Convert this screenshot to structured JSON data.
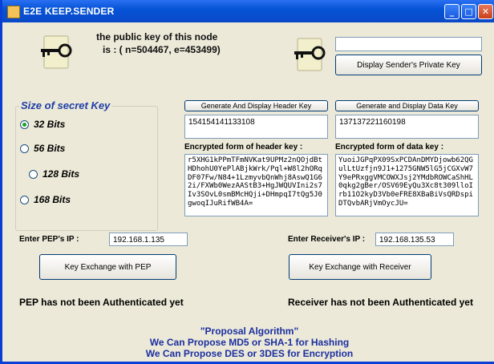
{
  "window": {
    "title": "E2E KEEP.SENDER",
    "buttons": [
      "minimize",
      "maximize",
      "close"
    ]
  },
  "public_key": {
    "line1": "the public key of this node",
    "line2": "is : ( n=504467, e=453499)"
  },
  "private_key": {
    "field_value": "",
    "button_label": "Display Sender's Private Key"
  },
  "secret_key_size": {
    "title": "Size of secret Key",
    "options": [
      "32 Bits",
      "56 Bits",
      "128 Bits",
      "168 Bits"
    ],
    "selected": "32 Bits"
  },
  "header_key": {
    "button_label": "Generate And Display Header Key",
    "value": "154154141133108",
    "encrypted_label": "Encrypted form of header key :",
    "encrypted_value": "r5XHG1kPPmTFmNVKat9UPMz2nQOjdBtHDhohU0YePlABjkWrk/Pql+W8l2hORqDF07Fw/N84+1LzmyvbQnWhj8AswQ1G62i/FXWb0WezAAStB3+HgJWQUVIni2s7Iv3SOvL0smBMcHQji+DHmpqI7tQg5J0gwoqIJuRifWB4A="
  },
  "data_key": {
    "button_label": "Generate and Display Data Key",
    "value": "137137221160198",
    "encrypted_label": "Encrypted form of data key :",
    "encrypted_value": "YuoiJGPqPX09SxPCDAnDMYDjowb62QGulLtUzfjn9J1+1275GNW5lG5jCGXvW7Y9ePRxggVMCOWXJsj2YMdbROWCaShHL0qkg2gBer/OSV69EyQu3Xc8t309lloIrb11O2kyD3Vb0eFRE8XBaBiVsQRDspiDTQvbARjVmOycJU="
  },
  "pep": {
    "ip_label": "Enter PEP's IP :",
    "ip_value": "192.168.1.135",
    "button_label": "Key Exchange with PEP",
    "status": "PEP has not been Authenticated yet"
  },
  "receiver": {
    "ip_label": "Enter Receiver's IP :",
    "ip_value": "192.168.135.53",
    "button_label": "Key Exchange with Receiver",
    "status": "Receiver has not been Authenticated yet"
  },
  "proposal": {
    "line1": "\"Proposal Algorithm\"",
    "line2": "We Can Propose MD5 or SHA-1 for Hashing",
    "line3": "We Can Propose DES or 3DES for Encryption"
  },
  "colors": {
    "titlebar": "#0553d6",
    "window_bg": "#ece9d8",
    "group_title": "#1f3da8",
    "proposal_text": "#1b2fa0",
    "radio_checked": "#21a121"
  },
  "icons": [
    "app-icon",
    "key-lock-icon",
    "minimize-icon",
    "maximize-icon",
    "close-icon"
  ]
}
